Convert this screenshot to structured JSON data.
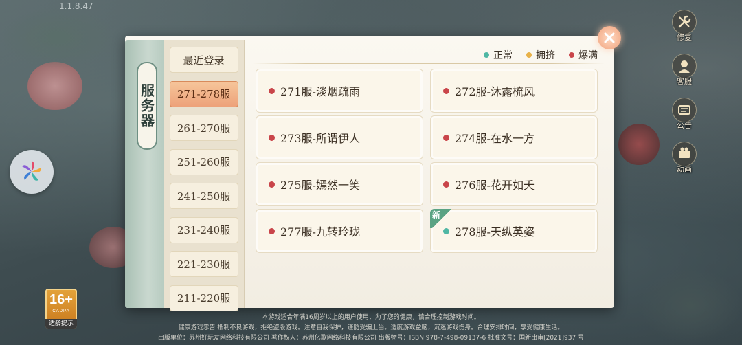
{
  "version": "1.1.8.47",
  "panel": {
    "title": "服务器"
  },
  "tabs": [
    {
      "label": "最近登录",
      "active": false
    },
    {
      "label": "271-278服",
      "active": true
    },
    {
      "label": "261-270服",
      "active": false
    },
    {
      "label": "251-260服",
      "active": false
    },
    {
      "label": "241-250服",
      "active": false
    },
    {
      "label": "231-240服",
      "active": false
    },
    {
      "label": "221-230服",
      "active": false
    },
    {
      "label": "211-220服",
      "active": false
    }
  ],
  "legend": [
    {
      "label": "正常",
      "color": "#4fb7a4"
    },
    {
      "label": "拥挤",
      "color": "#e8b24a"
    },
    {
      "label": "爆满",
      "color": "#c9454a"
    }
  ],
  "servers": [
    {
      "name": "271服-淡烟疏雨",
      "status_color": "#c9454a",
      "is_new": false
    },
    {
      "name": "272服-沐露梳风",
      "status_color": "#c9454a",
      "is_new": false
    },
    {
      "name": "273服-所谓伊人",
      "status_color": "#c9454a",
      "is_new": false
    },
    {
      "name": "274服-在水一方",
      "status_color": "#c9454a",
      "is_new": false
    },
    {
      "name": "275服-嫣然一笑",
      "status_color": "#c9454a",
      "is_new": false
    },
    {
      "name": "276服-花开如夭",
      "status_color": "#c9454a",
      "is_new": false
    },
    {
      "name": "277服-九转玲珑",
      "status_color": "#c9454a",
      "is_new": false
    },
    {
      "name": "278服-天纵英姿",
      "status_color": "#4fb7a4",
      "is_new": true
    }
  ],
  "new_tag": "新",
  "side_menu": [
    {
      "label": "修复",
      "icon": "wrench-icon"
    },
    {
      "label": "客服",
      "icon": "customer-service-icon"
    },
    {
      "label": "公告",
      "icon": "notice-icon"
    },
    {
      "label": "动画",
      "icon": "film-icon"
    }
  ],
  "age_badge": {
    "rating": "16+",
    "org": "CADPA",
    "tip": "适龄提示"
  },
  "footer": {
    "line1": "本游戏适合年满16周岁以上的用户使用，为了您的健康，请合理控制游戏时间。",
    "line2": "健康游戏忠告  抵制不良游戏，拒绝盗版游戏。注意自我保护，谨防受骗上当。适度游戏益脑，沉迷游戏伤身。合理安排时间，享受健康生活。",
    "line3": "出版单位：苏州好玩友网络科技有限公司   著作权人：苏州亿歌网络科技有限公司   出版物号：ISBN 978-7-498-09137-6   批准文号：国新出审[2021]937 号"
  }
}
